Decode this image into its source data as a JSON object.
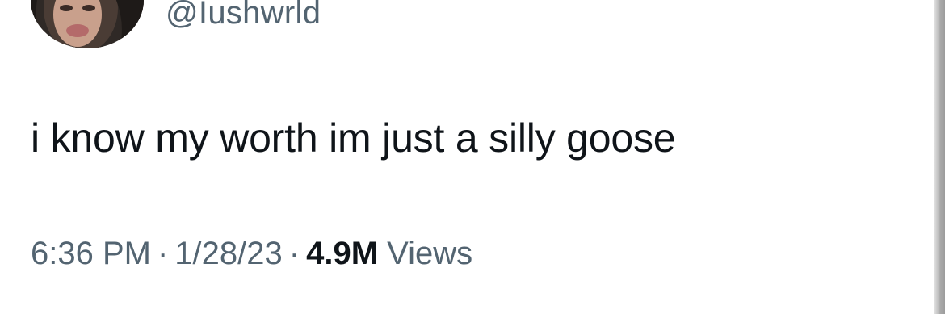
{
  "user": {
    "handle": "@Iushwrld"
  },
  "tweet": {
    "text": "i know my worth im just a silly goose"
  },
  "meta": {
    "time": "6:36 PM",
    "date": "1/28/23",
    "separator": "·",
    "views_count": "4.9M",
    "views_label": "Views"
  }
}
